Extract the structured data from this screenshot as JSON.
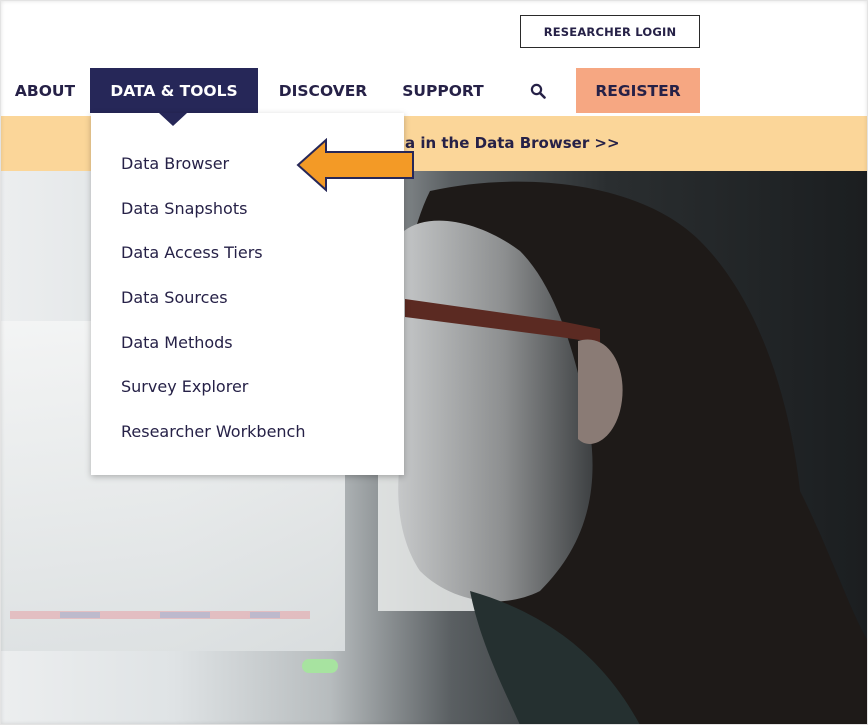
{
  "header": {
    "login_label": "RESEARCHER LOGIN"
  },
  "nav": {
    "items": [
      {
        "label": "ABOUT"
      },
      {
        "label": "DATA & TOOLS",
        "active": true
      },
      {
        "label": "DISCOVER"
      },
      {
        "label": "SUPPORT"
      }
    ],
    "search_icon": "search-icon",
    "register_label": "REGISTER"
  },
  "banner": {
    "text": "a in the Data Browser >>"
  },
  "dropdown": {
    "items": [
      {
        "label": "Data Browser"
      },
      {
        "label": "Data Snapshots"
      },
      {
        "label": "Data Access Tiers"
      },
      {
        "label": "Data Sources"
      },
      {
        "label": "Data Methods"
      },
      {
        "label": "Survey Explorer"
      },
      {
        "label": "Researcher Workbench"
      }
    ]
  },
  "annotation": {
    "icon": "arrow-left-icon",
    "color": "#f39a26",
    "outline_color": "#262758"
  },
  "colors": {
    "navy": "#262758",
    "register_bg": "#f6a782",
    "banner_bg": "#fbd699"
  }
}
